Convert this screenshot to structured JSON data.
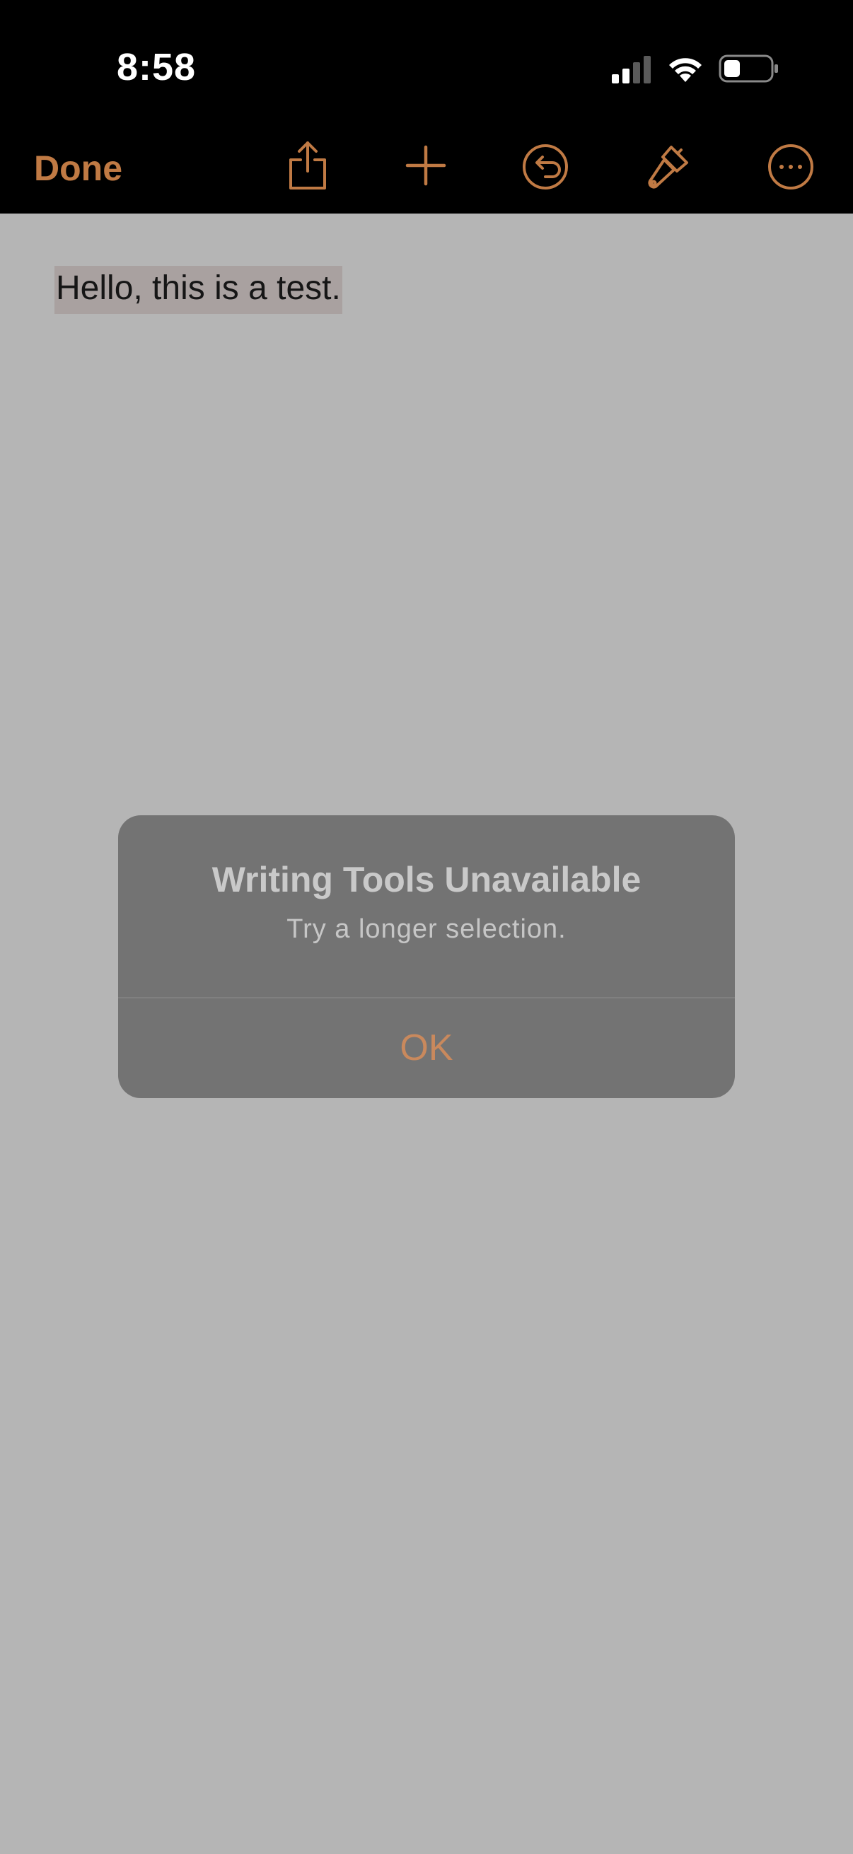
{
  "status_bar": {
    "time": "8:58",
    "icons": [
      "cellular-signal-icon",
      "wifi-icon",
      "battery-icon"
    ]
  },
  "toolbar": {
    "done_label": "Done",
    "icons": [
      "share-icon",
      "add-icon",
      "undo-icon",
      "paintbrush-icon",
      "more-icon"
    ]
  },
  "document": {
    "text": "Hello, this is a test."
  },
  "alert": {
    "title": "Writing Tools Unavailable",
    "message": "Try a longer selection.",
    "ok_label": "OK"
  },
  "colors": {
    "accent": "#c07a44",
    "toolbar_bg": "#000000",
    "document_bg": "#b5b5b5",
    "alert_bg": "#737373",
    "selection_highlight": "#a9a1a0"
  }
}
